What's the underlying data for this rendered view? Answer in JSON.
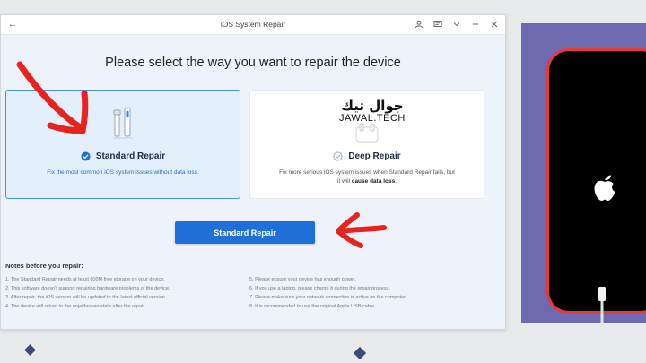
{
  "window": {
    "title": "iOS System Repair"
  },
  "main": {
    "heading": "Please select the way you want to repair the device",
    "primary_button": "Standard Repair"
  },
  "cards": {
    "standard": {
      "title": "Standard Repair",
      "description": "Fix the most common iOS system issues without data loss.",
      "selected": true
    },
    "deep": {
      "title": "Deep Repair",
      "description_prefix": "Fix more serious iOS system issues when Standard Repair fails, but it will ",
      "description_bold": "cause data loss",
      "description_suffix": ".",
      "selected": false
    }
  },
  "watermark": {
    "arabic": "جوال تيك",
    "latin": "JAWAL.TECH"
  },
  "notes": {
    "title": "Notes before you repair:",
    "left": [
      "1. The Standard Repair needs at least 800M free storage on your device.",
      "2. This software doesn't support repairing hardware problems of the device.",
      "3. After repair, the iOS version will be updated to the latest official version.",
      "4. The device will return to the unjailbroken state after the repair."
    ],
    "right": [
      "5. Please ensure your device has enough power.",
      "6. If you use a laptop, please charge it during the repair process.",
      "7. Please make sure your network connection is active on the computer.",
      "8. It is recommended to use the original Apple USB cable."
    ]
  },
  "icons": {
    "back": "back-arrow-icon",
    "account": "user-icon",
    "feedback": "message-icon",
    "menu": "chevron-down-icon",
    "minimize": "minimize-icon",
    "close": "close-icon",
    "apple": "apple-logo-icon"
  },
  "colors": {
    "accent": "#1f6fd6",
    "selected_card_bg": "#e4effc",
    "annotation_red": "#e8231f",
    "phone_red": "#e53a3e",
    "phone_bg": "#6e6ab1"
  }
}
